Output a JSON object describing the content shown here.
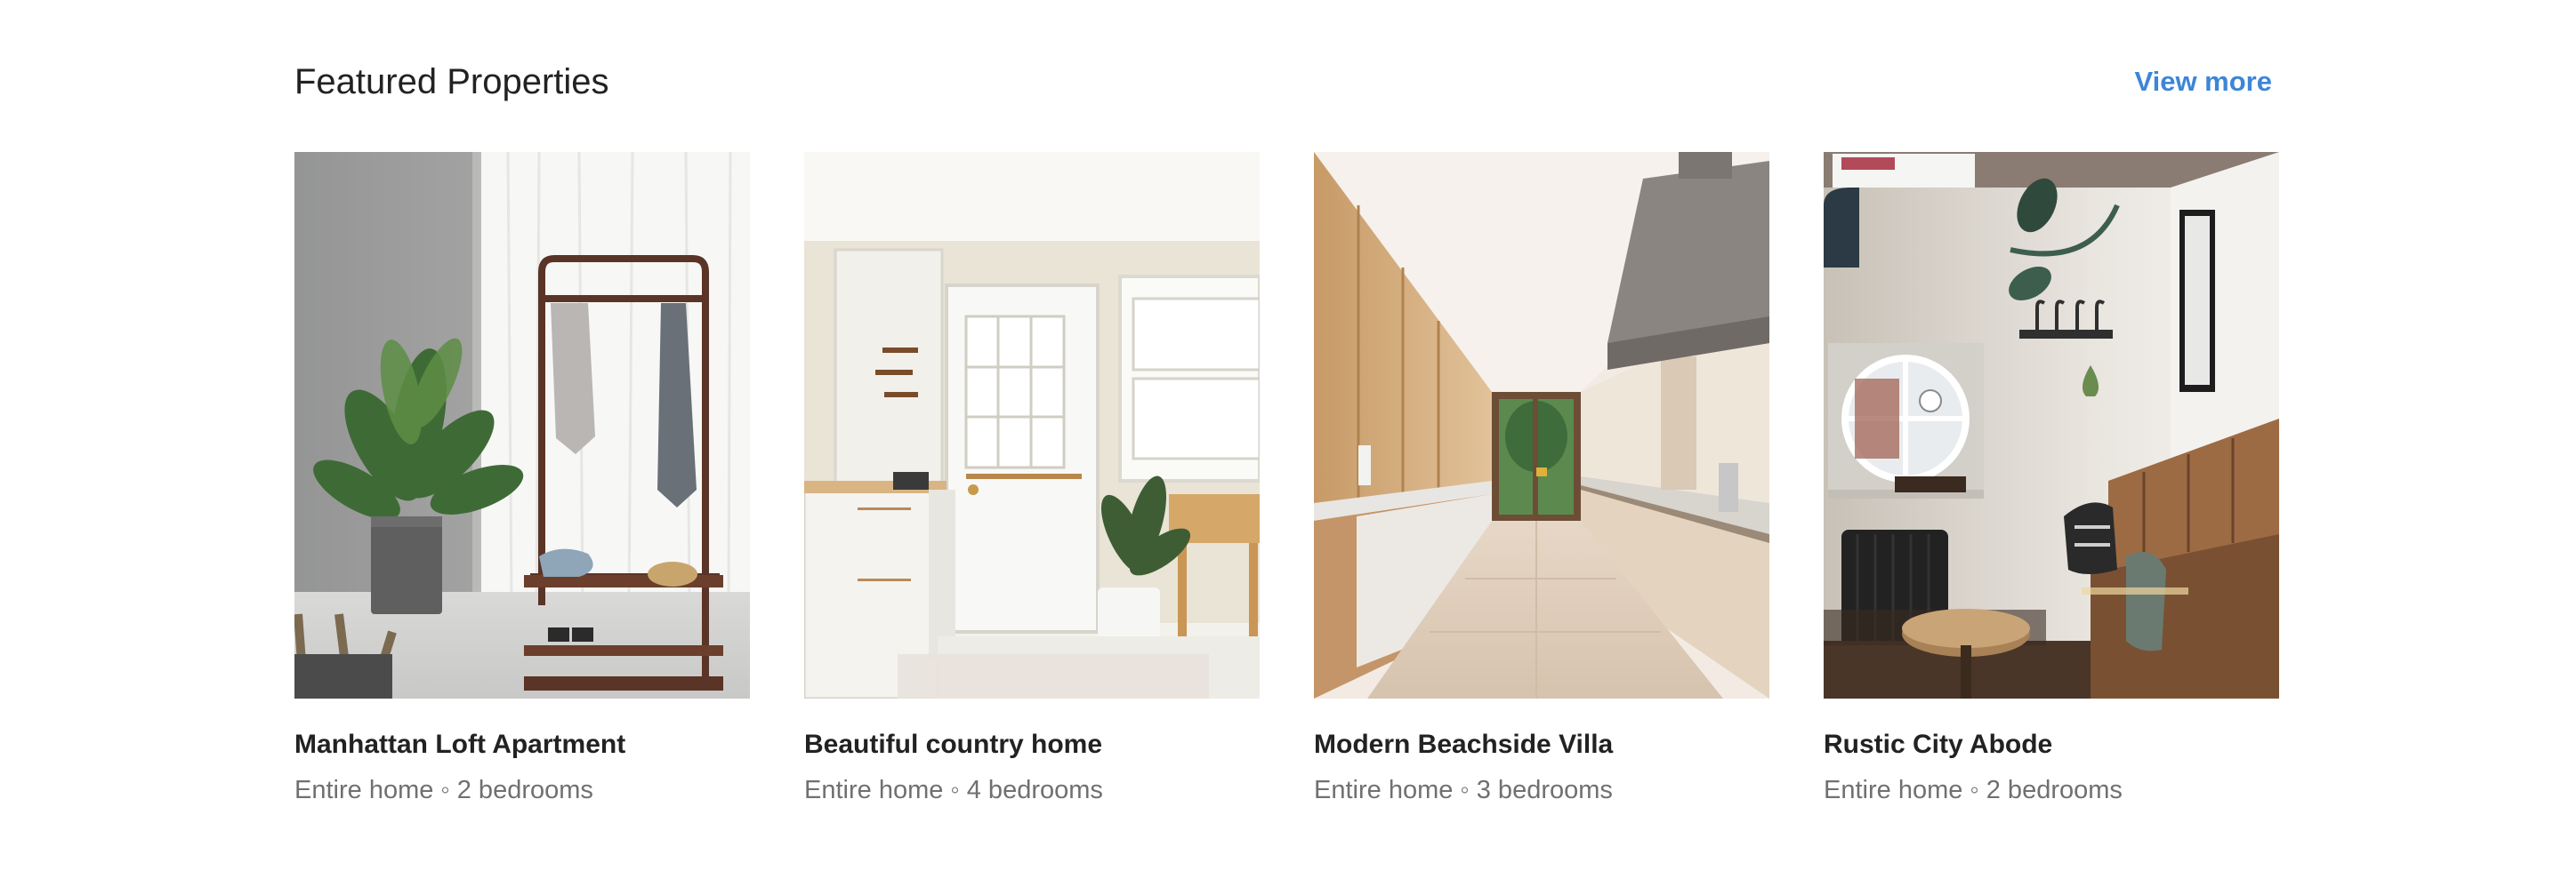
{
  "section": {
    "title": "Featured Properties",
    "view_more_label": "View more",
    "accent_color": "#3d86d6"
  },
  "properties": [
    {
      "title": "Manhattan Loft Apartment",
      "meta": "Entire home ◦ 2 bedrooms",
      "photo": "loft-with-clothing-rack-photo"
    },
    {
      "title": "Beautiful country home",
      "meta": "Entire home ◦ 4 bedrooms",
      "photo": "white-kitchen-with-door-photo"
    },
    {
      "title": "Modern Beachside Villa",
      "meta": "Entire home ◦ 3 bedrooms",
      "photo": "long-wooden-galley-kitchen-photo"
    },
    {
      "title": "Rustic City Abode",
      "meta": "Entire home ◦ 2 bedrooms",
      "photo": "nook-with-round-window-photo"
    }
  ]
}
